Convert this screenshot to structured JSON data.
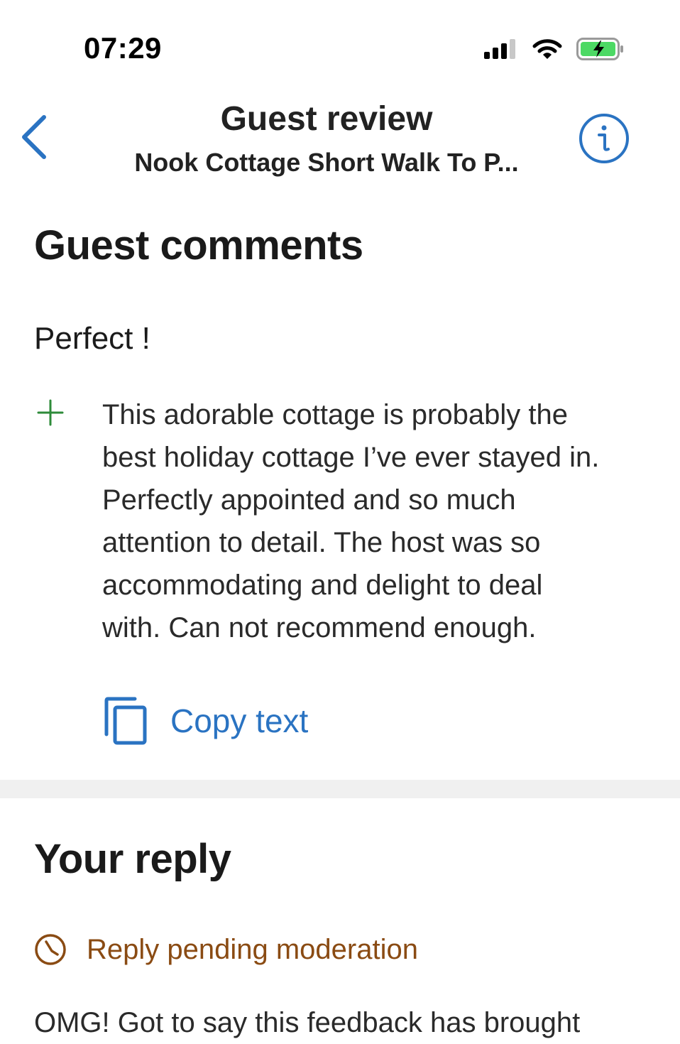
{
  "status_bar": {
    "time": "07:29"
  },
  "header": {
    "title": "Guest review",
    "subtitle": "Nook Cottage Short Walk To P..."
  },
  "guest_comments": {
    "heading": "Guest comments",
    "review_title": "Perfect !",
    "positive_text": "This adorable cottage is probably the\nbest holiday cottage I’ve ever stayed in.\nPerfectly appointed and so much\nattention to detail. The host was so\naccommodating and delight to deal\nwith. Can not recommend enough.",
    "copy_label": "Copy text"
  },
  "reply": {
    "heading": "Your reply",
    "status": "Reply pending moderation",
    "text": "OMG! Got to say this feedback has brought"
  },
  "colors": {
    "accent_blue": "#2a73c2",
    "positive_green": "#2e8b3a",
    "pending_brown": "#8a4b13",
    "battery_green": "#4cd964"
  },
  "icons": {
    "back": "chevron-left-icon",
    "info": "info-icon",
    "plus": "plus-icon",
    "copy": "copy-icon",
    "clock": "clock-icon"
  }
}
